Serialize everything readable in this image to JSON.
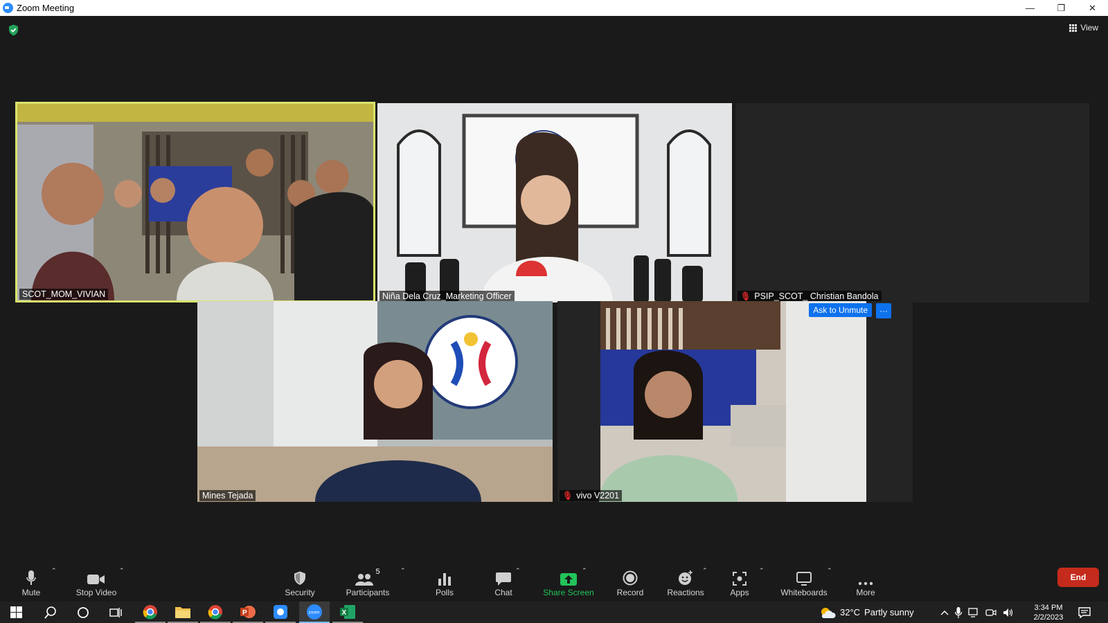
{
  "window": {
    "title": "Zoom Meeting",
    "minimize_glyph": "—",
    "restore_glyph": "❐",
    "close_glyph": "✕"
  },
  "meeting": {
    "view_label": "View",
    "encryption_icon": "shield-check-icon",
    "tiles": [
      {
        "name": "SCOT_MOM_VIVIAN",
        "muted": false,
        "active_speaker": true
      },
      {
        "name": "Niña Dela Cruz_Marketing Officer",
        "muted": false
      },
      {
        "name": "PSIP_SCOT_ Christian Bandola",
        "muted": true
      },
      {
        "name": "Mines Tejada",
        "muted": false
      },
      {
        "name": "vivo V2201",
        "muted": true,
        "ask_to_unmute": "Ask to Unmute",
        "more_glyph": "···"
      }
    ]
  },
  "toolbar": {
    "mute": "Mute",
    "stop_video": "Stop Video",
    "security": "Security",
    "participants": "Participants",
    "participants_count": "5",
    "polls": "Polls",
    "chat": "Chat",
    "share_screen": "Share Screen",
    "record": "Record",
    "reactions": "Reactions",
    "apps": "Apps",
    "whiteboards": "Whiteboards",
    "more": "More",
    "end": "End",
    "caret": "⌃"
  },
  "taskbar": {
    "weather_temp": "32°C",
    "weather_text": "Partly sunny",
    "time": "3:34 PM",
    "date": "2/2/2023",
    "zoom_label": "zoom"
  },
  "colors": {
    "accent_blue": "#0e72ed",
    "share_green": "#22c35a",
    "end_red": "#c42b1c",
    "speaker_border": "#d9e36b"
  }
}
